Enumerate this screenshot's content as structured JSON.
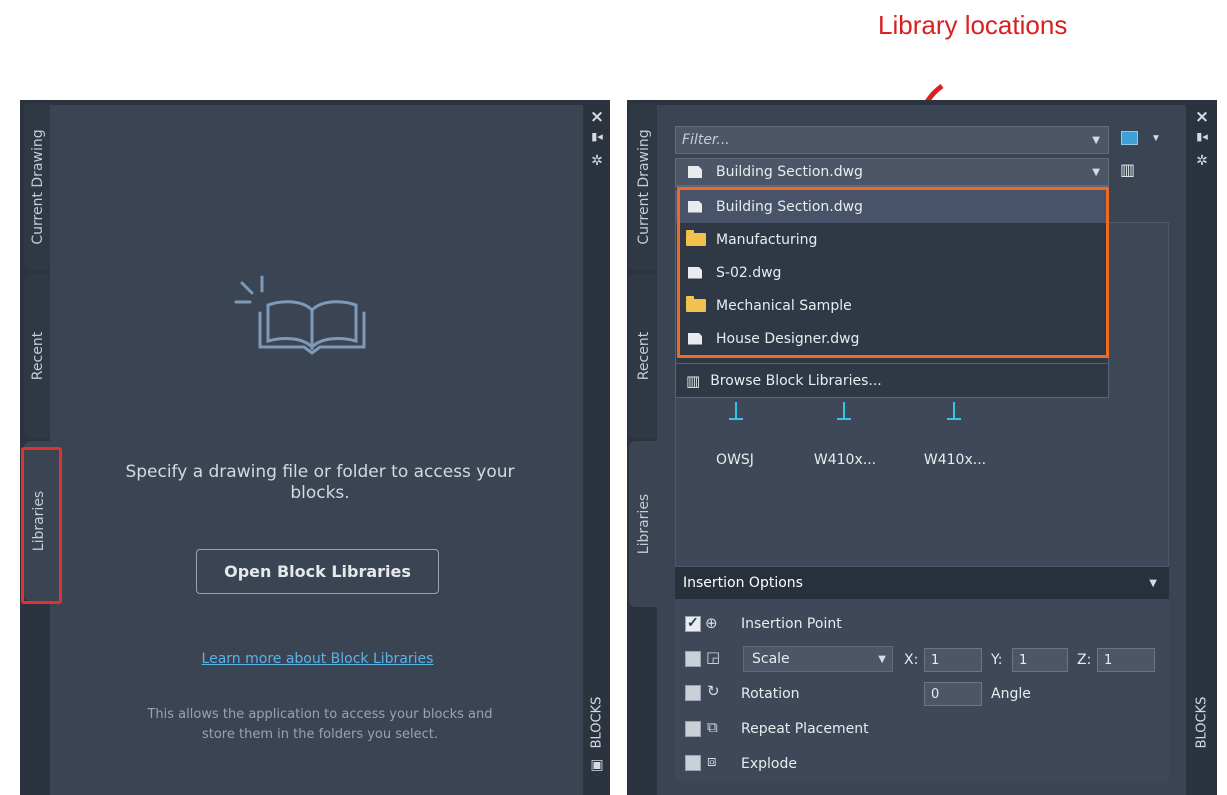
{
  "callout": {
    "text": "Library locations",
    "color": "#d8201f"
  },
  "tabs": {
    "current_drawing": "Current Drawing",
    "recent": "Recent",
    "libraries": "Libraries"
  },
  "palette_title": "BLOCKS",
  "left_panel": {
    "message": "Specify a drawing file or folder to access your blocks.",
    "open_button": "Open Block Libraries",
    "learn_link": "Learn more about Block Libraries",
    "allows_text": "This allows the application to access your blocks and store them in the folders you select."
  },
  "right_panel": {
    "filter_placeholder": "Filter...",
    "library_selected": "Building Section.dwg",
    "library_items": [
      {
        "label": "Building Section.dwg",
        "icon": "document-icon"
      },
      {
        "label": "Manufacturing",
        "icon": "folder-icon"
      },
      {
        "label": "S-02.dwg",
        "icon": "document-icon"
      },
      {
        "label": "Mechanical Sample",
        "icon": "folder-icon"
      },
      {
        "label": "House Designer.dwg",
        "icon": "document-icon"
      }
    ],
    "browse_label": "Browse Block Libraries...",
    "blocks": [
      "OWSJ",
      "W410x...",
      "W410x..."
    ],
    "insertion_options": {
      "title": "Insertion Options",
      "insertion_point": "Insertion Point",
      "scale_label": "Scale",
      "x_label": "X:",
      "x_value": "1",
      "y_label": "Y:",
      "y_value": "1",
      "z_label": "Z:",
      "z_value": "1",
      "rotation": "Rotation",
      "rotation_value": "0",
      "angle": "Angle",
      "repeat": "Repeat Placement",
      "explode": "Explode"
    }
  },
  "colors": {
    "panel_bg": "#3b4453",
    "frame_bg": "#2b333e",
    "highlight_red": "#e0332f",
    "highlight_orange": "#ef6b25",
    "link": "#5ab3e6"
  }
}
